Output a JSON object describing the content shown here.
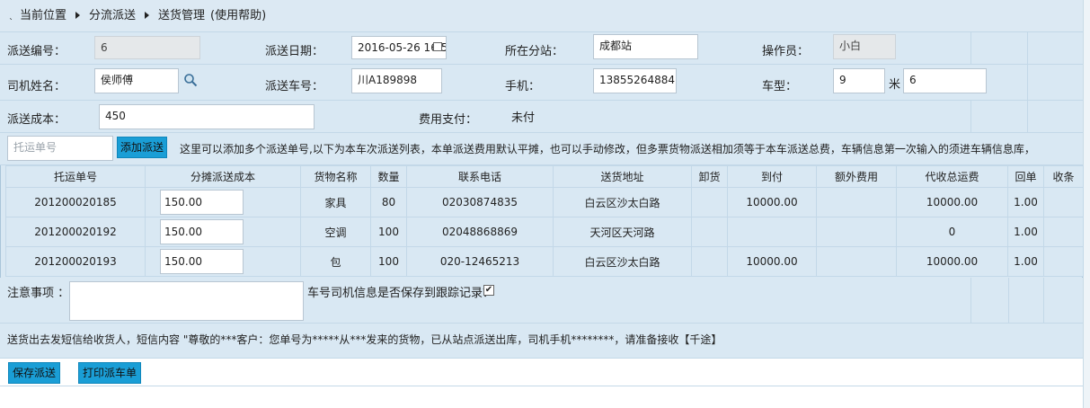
{
  "breadcrumb": {
    "prefix": "`",
    "item1": "当前位置",
    "item2": "分流派送",
    "item3": "送货管理",
    "help": "(使用帮助)"
  },
  "form": {
    "dispatch_no_label": "派送编号：",
    "dispatch_no": "6",
    "dispatch_date_label": "派送日期：",
    "dispatch_date": "2016-05-26 16:5",
    "branch_label": "所在分站：",
    "branch": "成都站",
    "operator_label": "操作员：",
    "operator": "小白",
    "driver_label": "司机姓名：",
    "driver": "侯师傅",
    "vehicle_label": "派送车号：",
    "vehicle": "川A189898",
    "phone_label": "手机：",
    "phone": "13855264884",
    "car_type_label": "车型：",
    "car_type_a": "9",
    "car_type_sep": "米",
    "car_type_b": "6",
    "cost_label": "派送成本：",
    "cost": "450",
    "payment_label": "费用支付：",
    "payment": "未付"
  },
  "add_row": {
    "waybill_placeholder": "托运单号",
    "add_button": "添加派送",
    "hint": "这里可以添加多个派送单号,以下为本车次派送列表，本单派送费用默认平摊，也可以手动修改，但多票货物派送相加须等于本车派送总费，车辆信息第一次输入的须进车辆信息库，"
  },
  "table": {
    "headers": [
      "托运单号",
      "分摊派送成本",
      "货物名称",
      "数量",
      "联系电话",
      "送货地址",
      "卸货",
      "到付",
      "额外费用",
      "代收总运费",
      "回单",
      "收条"
    ],
    "rows": [
      [
        "201200020185",
        "150.00",
        "家具",
        "80",
        "02030874835",
        "白云区沙太白路",
        "",
        "10000.00",
        "",
        "10000.00",
        "1.00",
        ""
      ],
      [
        "201200020192",
        "150.00",
        "空调",
        "100",
        "02048868869",
        "天河区天河路",
        "",
        "",
        "",
        "0",
        "1.00",
        ""
      ],
      [
        "201200020193",
        "150.00",
        "包",
        "100",
        "020-12465213",
        "白云区沙太白路",
        "",
        "10000.00",
        "",
        "10000.00",
        "1.00",
        ""
      ]
    ]
  },
  "notes": {
    "label": "注意事项 ：",
    "save_driver_label": "车号司机信息是否保存到跟踪记录？",
    "save_driver_checked": true,
    "sms_text": "送货出去发短信给收货人，短信内容 \"尊敬的***客户：您单号为*****从***发来的货物，已从站点派送出库，司机手机********，请准备接收【千途】"
  },
  "actions": {
    "save": "保存派送",
    "print": "打印派车单"
  }
}
